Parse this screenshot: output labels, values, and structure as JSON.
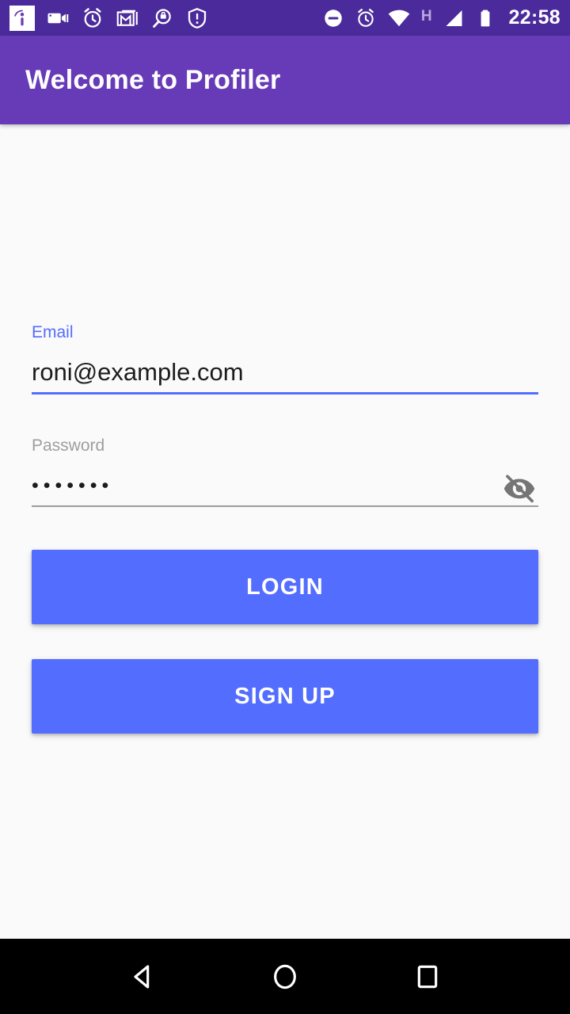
{
  "status_bar": {
    "background_color": "#4B2B9B",
    "left_icons": [
      {
        "name": "info-icon",
        "label": "info"
      },
      {
        "name": "videocam-icon",
        "label": "videocam"
      },
      {
        "name": "alarm-icon",
        "label": "alarm"
      },
      {
        "name": "gmail-icon",
        "label": "gmail"
      },
      {
        "name": "search-bag-icon",
        "label": "search"
      },
      {
        "name": "security-warning-icon",
        "label": "security warning"
      }
    ],
    "right_icons": [
      {
        "name": "do-not-disturb-icon",
        "label": "do not disturb"
      },
      {
        "name": "alarm-set-icon",
        "label": "alarm set"
      },
      {
        "name": "wifi-icon",
        "label": "wifi"
      },
      {
        "name": "network-type-label",
        "label": "H"
      },
      {
        "name": "cell-signal-icon",
        "label": "cell signal"
      },
      {
        "name": "battery-icon",
        "label": "battery"
      }
    ],
    "time": "22:58",
    "network_type": "H"
  },
  "app_bar": {
    "title": "Welcome to Profiler",
    "background_color": "#673AB7"
  },
  "form": {
    "email": {
      "label": "Email",
      "value": "roni@example.com",
      "placeholder": "Email",
      "focused": true,
      "label_color": "#536DFE",
      "underline_color": "#536DFE"
    },
    "password": {
      "label": "Password",
      "value": "•••••••",
      "placeholder": "Password",
      "focused": false,
      "label_color": "#9E9E9E",
      "underline_color": "#9B9B9B",
      "visibility_toggle": {
        "icon": "visibility-off-icon",
        "state": "hidden"
      }
    },
    "buttons": [
      {
        "name": "login-button",
        "label": "LOGIN",
        "color": "#536DFE"
      },
      {
        "name": "signup-button",
        "label": "SIGN UP",
        "color": "#536DFE"
      }
    ]
  },
  "nav_bar": {
    "background_color": "#000000",
    "buttons": [
      {
        "name": "nav-back-button",
        "label": "Back"
      },
      {
        "name": "nav-home-button",
        "label": "Home"
      },
      {
        "name": "nav-recents-button",
        "label": "Recents"
      }
    ]
  },
  "page": {
    "background_color": "#FAFAFA"
  }
}
